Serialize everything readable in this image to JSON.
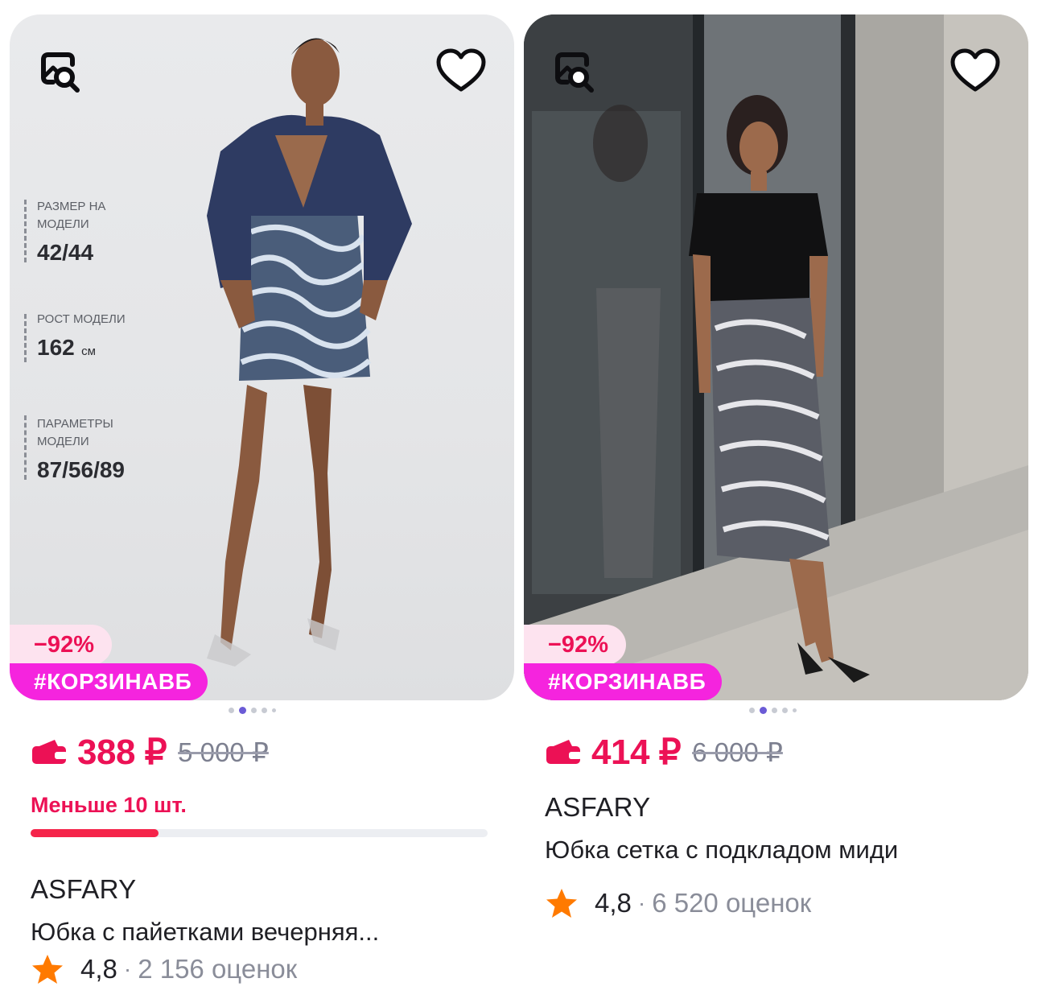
{
  "products": [
    {
      "badge_discount": "−92%",
      "badge_tag": "#КОРЗИНАВБ",
      "price": "388 ₽",
      "old_price": "5 000 ₽",
      "stock_text": "Меньше 10 шт.",
      "stock_level": 0.28,
      "brand": "ASFARY",
      "title": "Юбка с пайетками вечерняя...",
      "rating": "4,8",
      "rating_sep": "·",
      "reviews": "2 156 оценок",
      "photo_overlay": [
        {
          "label": "РАЗМЕР НА МОДЕЛИ",
          "value": "42/44",
          "unit": ""
        },
        {
          "label": "РОСТ МОДЕЛИ",
          "value": "162",
          "unit": "см"
        },
        {
          "label": "ПАРАМЕТРЫ МОДЕЛИ",
          "value": "87/56/89",
          "unit": ""
        }
      ]
    },
    {
      "badge_discount": "−92%",
      "badge_tag": "#КОРЗИНАВБ",
      "price": "414 ₽",
      "old_price": "6 000 ₽",
      "brand": "ASFARY",
      "title": "Юбка сетка с подкладом миди",
      "rating": "4,8",
      "rating_sep": "·",
      "reviews": "6 520 оценок"
    }
  ],
  "colors": {
    "accent": "#ec1155",
    "tag": "#f524de",
    "star": "#ff7a00",
    "muted": "#8a8d99"
  },
  "icons": {
    "search": "image-search-icon",
    "favorite": "heart-icon",
    "wallet": "wallet-icon",
    "rating": "star-icon"
  }
}
